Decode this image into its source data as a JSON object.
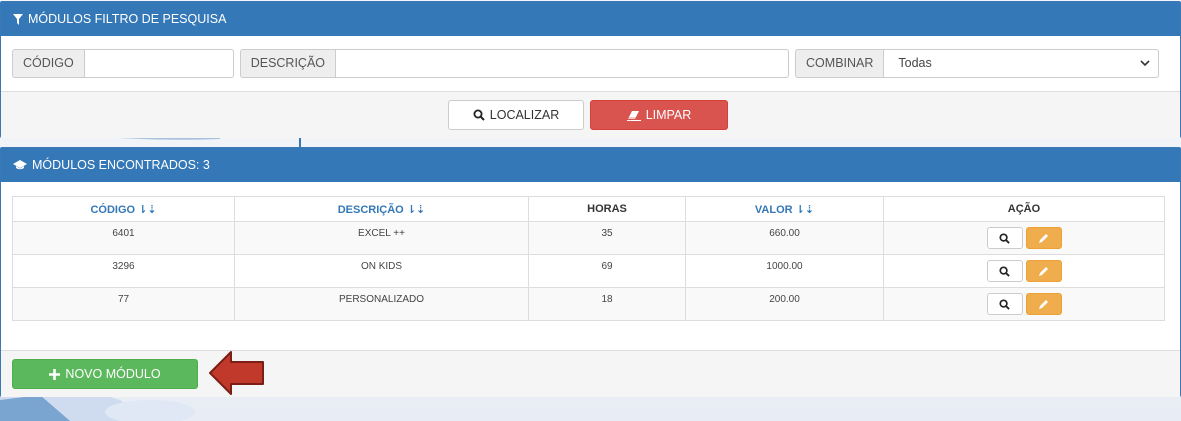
{
  "filter": {
    "title": "MÓDULOS FILTRO DE PESQUISA",
    "codigo_label": "CÓDIGO",
    "codigo_value": "",
    "descricao_label": "DESCRIÇÃO",
    "descricao_value": "",
    "combinar_label": "COMBINAR",
    "combinar_value": "Todas",
    "localizar_label": "LOCALIZAR",
    "limpar_label": "LIMPAR"
  },
  "results": {
    "title": "MÓDULOS ENCONTRADOS: 3",
    "columns": {
      "codigo": "CÓDIGO",
      "descricao": "DESCRIÇÃO",
      "horas": "HORAS",
      "valor": "VALOR",
      "acao": "AÇÃO"
    },
    "rows": [
      {
        "codigo": "6401",
        "descricao": "EXCEL ++",
        "horas": "35",
        "valor": "660.00"
      },
      {
        "codigo": "3296",
        "descricao": "ON KIDS",
        "horas": "69",
        "valor": "1000.00"
      },
      {
        "codigo": "77",
        "descricao": "PERSONALIZADO",
        "horas": "18",
        "valor": "200.00"
      }
    ],
    "novo_label": "NOVO MÓDULO"
  },
  "icons": {
    "filter": "filter-icon",
    "search": "search-icon",
    "eraser": "eraser-icon",
    "graduation": "graduation-cap-icon",
    "sort": "sort-alpha-icon",
    "view": "magnifier-icon",
    "edit": "pencil-icon",
    "plus": "plus-icon",
    "arrow": "red-arrow-icon"
  },
  "colors": {
    "primary": "#3478b7",
    "danger": "#d9534f",
    "success": "#5cb85c",
    "warning": "#f0ad4e",
    "arrow": "#b03a2e"
  }
}
